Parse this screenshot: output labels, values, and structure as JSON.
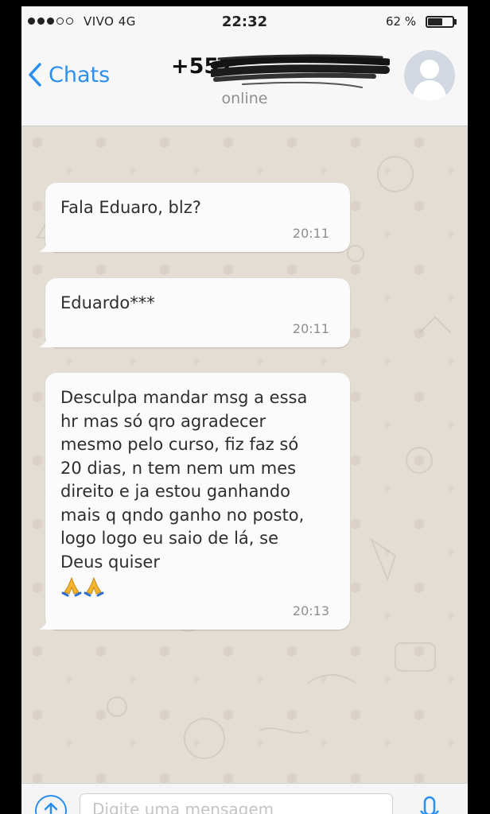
{
  "status_bar": {
    "carrier": "VIVO  4G",
    "time": "22:32",
    "battery_percent": "62 %",
    "battery_level": 0.62
  },
  "header": {
    "back_label": "Chats",
    "contact_number": "+557",
    "contact_status": "online"
  },
  "messages": [
    {
      "text": "Fala Eduaro, blz?",
      "time": "20:11"
    },
    {
      "text": "Eduardo***",
      "time": "20:11"
    },
    {
      "text": "Desculpa mandar msg a essa\nhr mas só qro agradecer\nmesmo pelo curso, fiz faz só\n20 dias, n tem nem um mes\ndireito e ja estou ganhando\nmais q qndo ganho no posto,\nlogo logo eu saio de lá, se\nDeus quiser",
      "time": "20:13",
      "emoji": [
        "folded-hands-icon",
        "folded-hands-icon"
      ]
    }
  ],
  "input": {
    "placeholder": "Digite uma mensagem"
  },
  "colors": {
    "accent": "#2b8ff0",
    "chat_background": "#e4ddd3",
    "bubble": "#fbfbfb"
  }
}
